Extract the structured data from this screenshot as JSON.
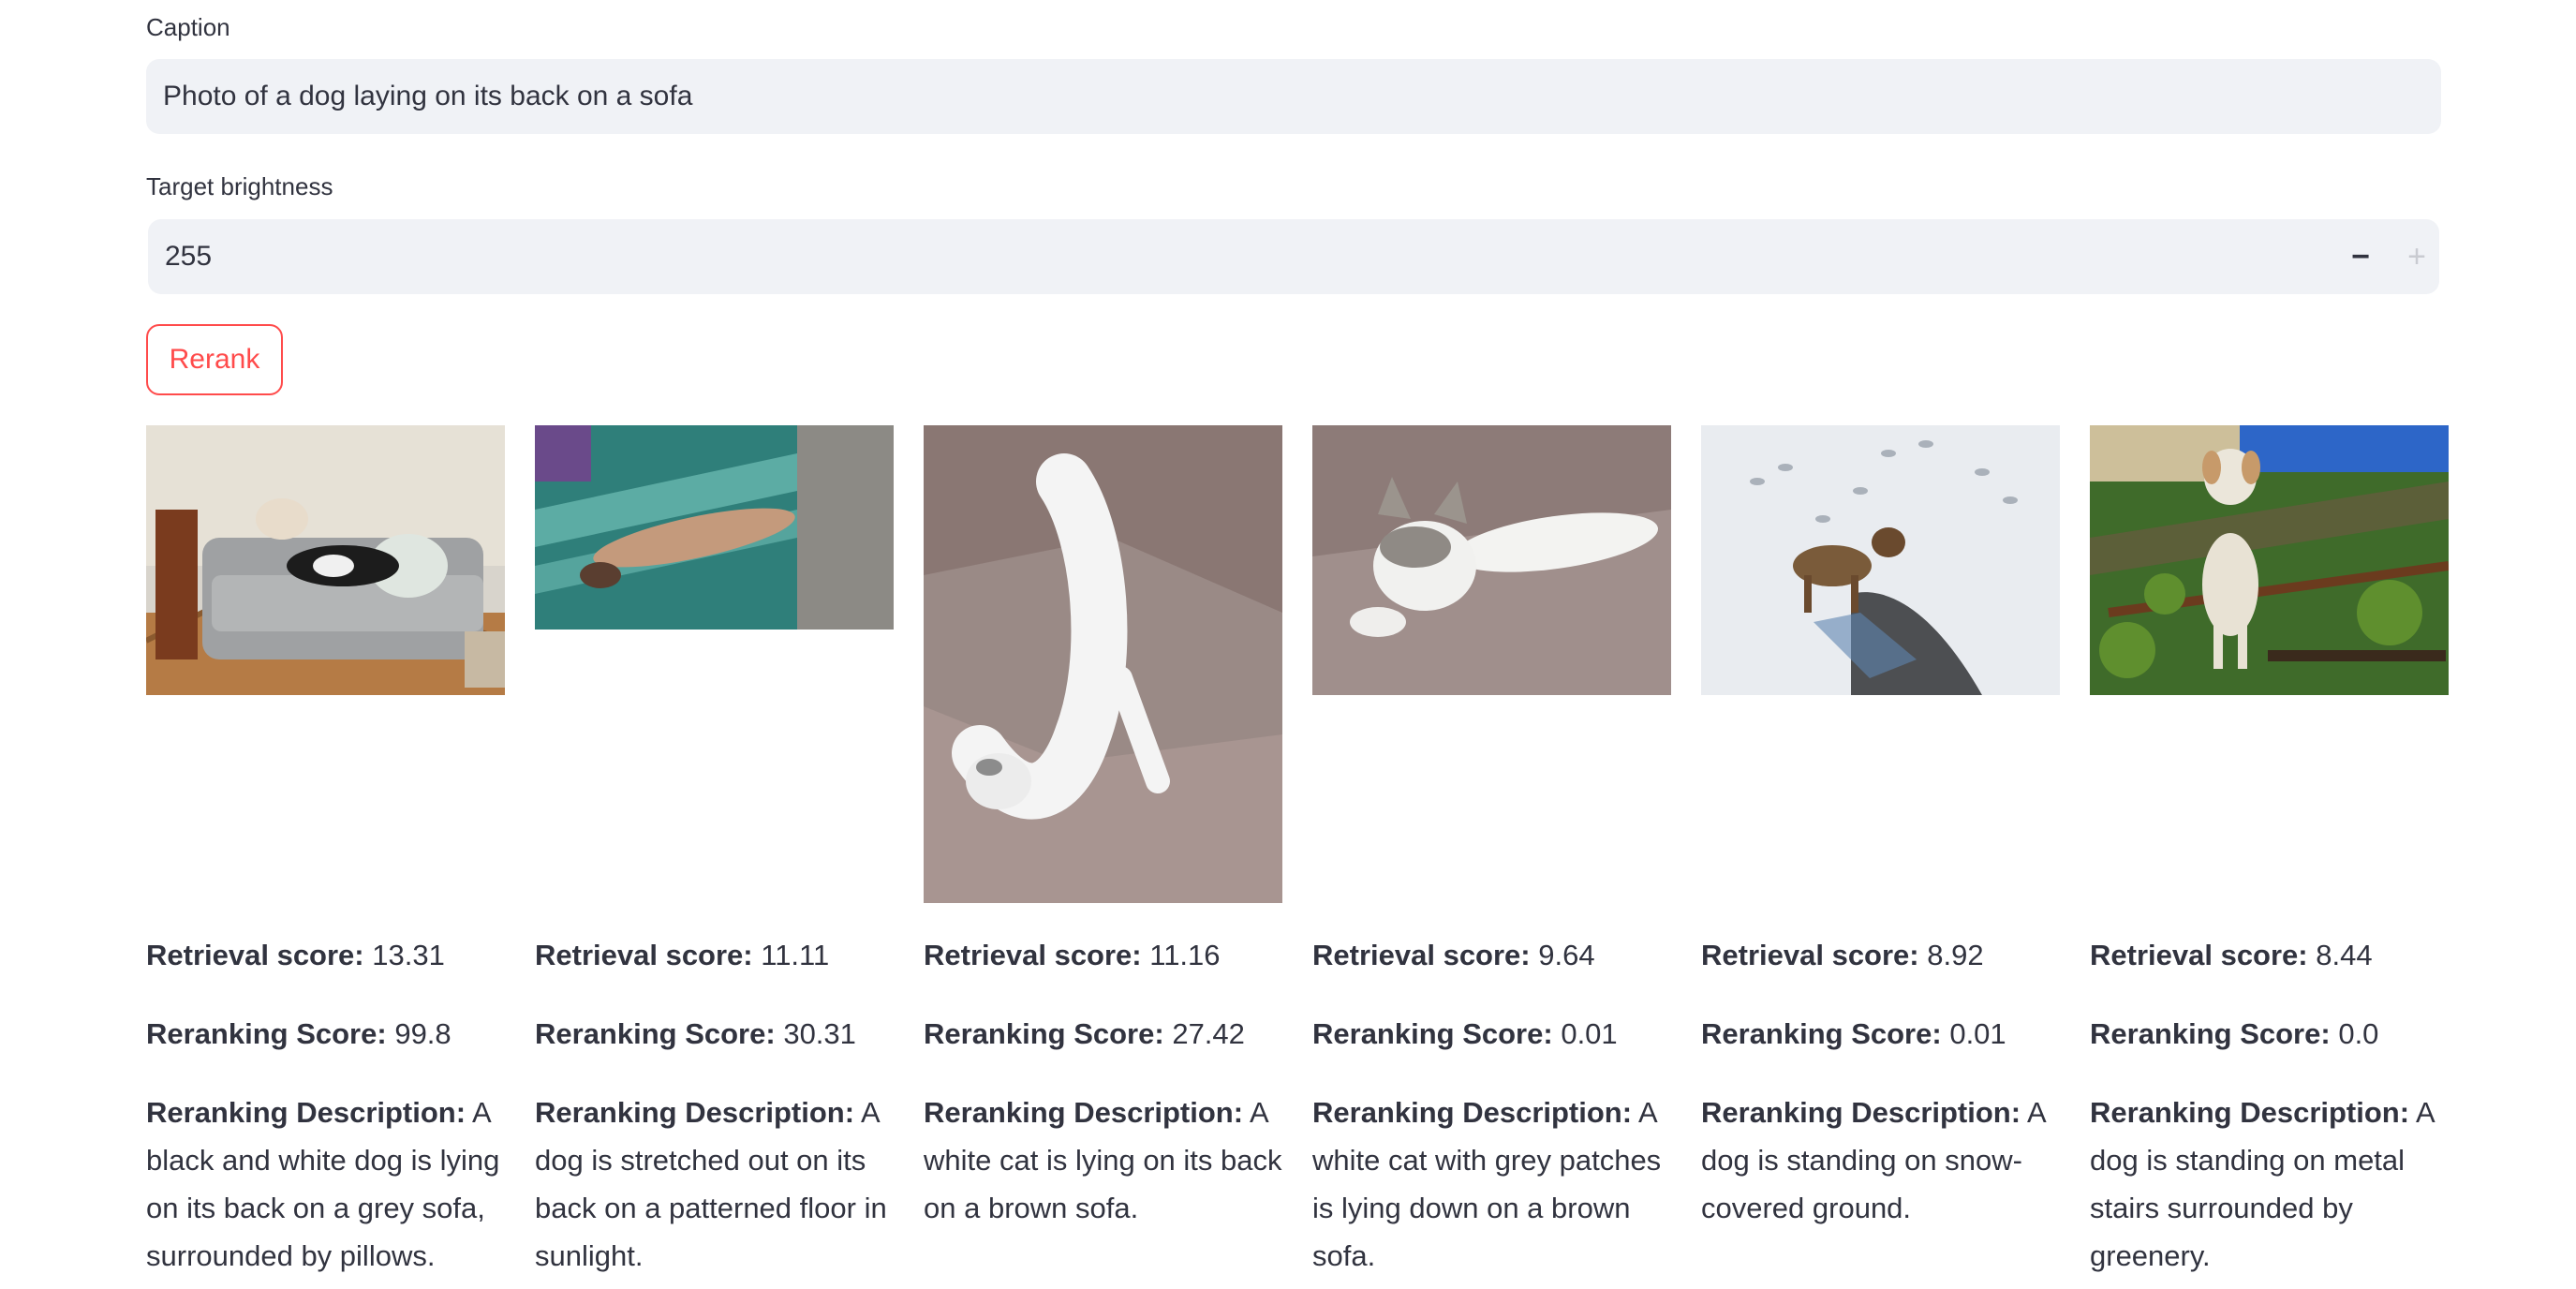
{
  "caption": {
    "label": "Caption",
    "value": "Photo of a dog laying on its back on a sofa"
  },
  "brightness": {
    "label": "Target brightness",
    "value": "255",
    "minus": "−",
    "plus": "+"
  },
  "rerank_button": "Rerank",
  "labels": {
    "retrieval": "Retrieval score:",
    "reranking": "Reranking Score:",
    "description": "Reranking Description:"
  },
  "results": [
    {
      "retrieval_score": "13.31",
      "reranking_score": "99.8",
      "description": "A black and white dog is lying on its back on a grey sofa, surrounded by pillows.",
      "image_icon": "dog-on-sofa-photo"
    },
    {
      "retrieval_score": "11.11",
      "reranking_score": "30.31",
      "description": "A dog is stretched out on its back on a patterned floor in sunlight.",
      "image_icon": "dog-on-floor-photo"
    },
    {
      "retrieval_score": "11.16",
      "reranking_score": "27.42",
      "description": "A white cat is lying on its back on a brown sofa.",
      "image_icon": "cat-on-sofa-photo"
    },
    {
      "retrieval_score": "9.64",
      "reranking_score": "0.01",
      "description": "A white cat with grey patches is lying down on a brown sofa.",
      "image_icon": "kitten-on-sofa-photo"
    },
    {
      "retrieval_score": "8.92",
      "reranking_score": "0.01",
      "description": "A dog is standing on snow-covered ground.",
      "image_icon": "dog-in-snow-photo"
    },
    {
      "retrieval_score": "8.44",
      "reranking_score": "0.0",
      "description": "A dog is standing on metal stairs surrounded by greenery.",
      "image_icon": "dog-on-stairs-photo"
    }
  ]
}
